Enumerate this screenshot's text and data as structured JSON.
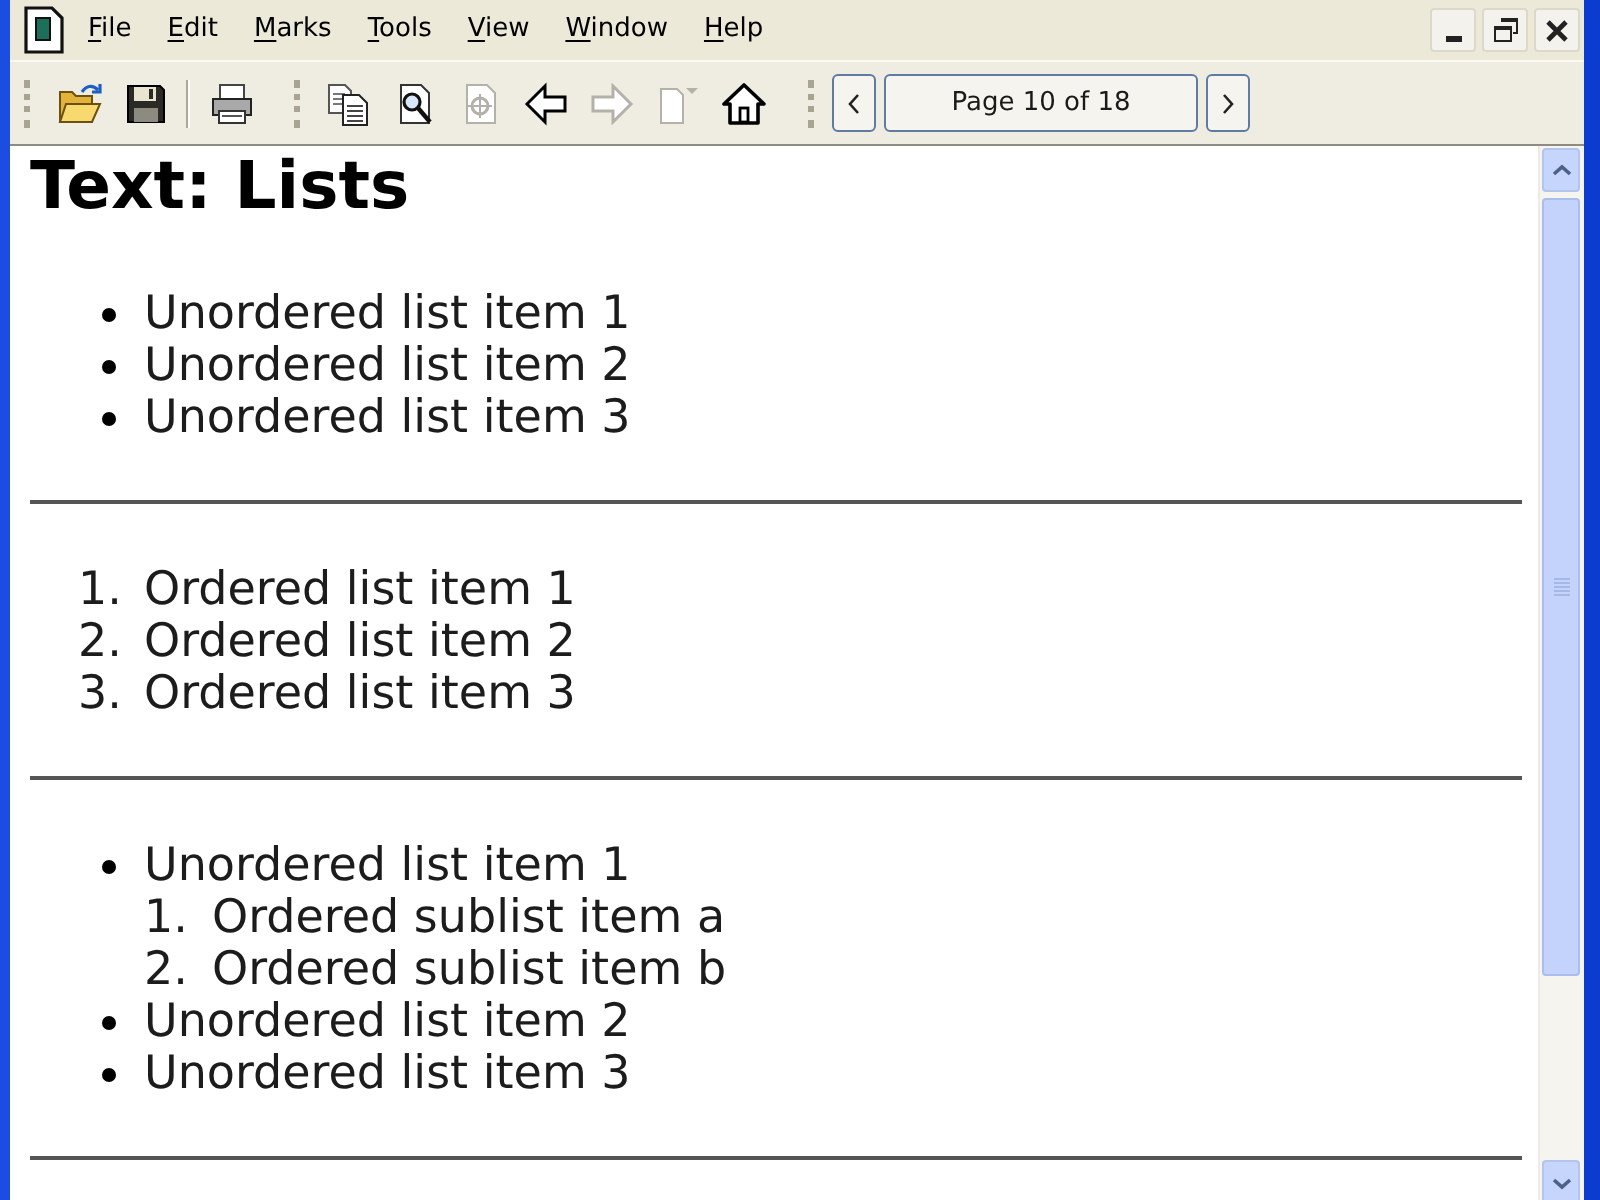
{
  "menu_bar": {
    "items": [
      {
        "label": "File"
      },
      {
        "label": "Edit"
      },
      {
        "label": "Marks"
      },
      {
        "label": "Tools"
      },
      {
        "label": "View"
      },
      {
        "label": "Window"
      },
      {
        "label": "Help"
      }
    ]
  },
  "toolbars": [
    {
      "groups": [
        [
          {
            "kind": "open",
            "disabled": false
          },
          {
            "kind": "save",
            "disabled": false
          }
        ],
        [
          {
            "kind": "print",
            "disabled": false
          }
        ]
      ]
    },
    {
      "groups": [
        [
          {
            "kind": "copy",
            "disabled": false
          },
          {
            "kind": "find",
            "disabled": false
          },
          {
            "kind": "extract",
            "disabled": true
          },
          {
            "kind": "back",
            "disabled": false
          },
          {
            "kind": "forward",
            "disabled": true
          },
          {
            "kind": "page",
            "disabled": true
          },
          {
            "kind": "home",
            "disabled": false
          }
        ]
      ]
    }
  ],
  "pager": {
    "page_label": "Page 10 of 18"
  },
  "document": {
    "heading": "Text: Lists",
    "sections": [
      {
        "kind": "unordered",
        "items": [
          {
            "text": "Unordered list item 1"
          },
          {
            "text": "Unordered list item 2"
          },
          {
            "text": "Unordered list item 3"
          }
        ]
      },
      {
        "kind": "ordered",
        "items": [
          {
            "marker": "1.",
            "text": "Ordered list item 1"
          },
          {
            "marker": "2.",
            "text": "Ordered list item 2"
          },
          {
            "marker": "3.",
            "text": "Ordered list item 3"
          }
        ]
      },
      {
        "kind": "unordered",
        "items": [
          {
            "text": "Unordered list item 1",
            "children": {
              "kind": "ordered",
              "items": [
                {
                  "marker": "1.",
                  "text": "Ordered sublist item a"
                },
                {
                  "marker": "2.",
                  "text": "Ordered sublist item b"
                }
              ]
            }
          },
          {
            "text": "Unordered list item 2"
          },
          {
            "text": "Unordered list item 3"
          }
        ]
      }
    ]
  }
}
